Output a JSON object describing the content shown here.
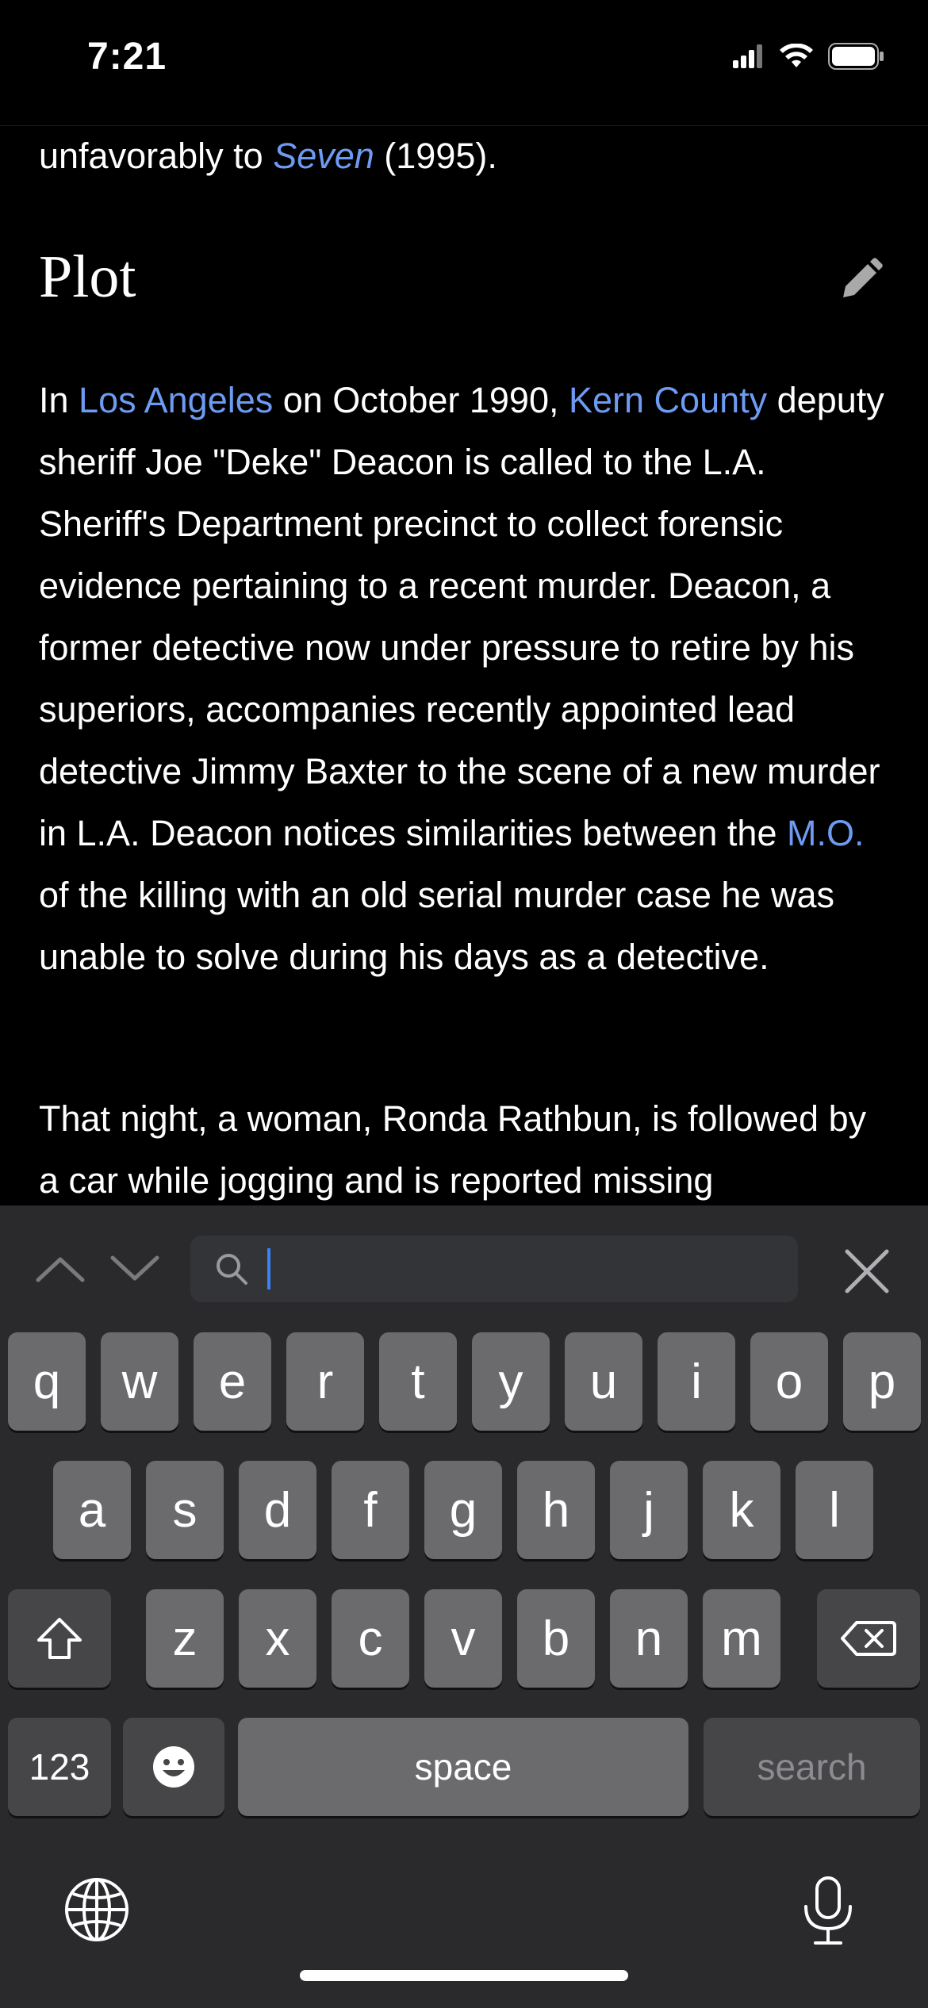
{
  "status": {
    "time": "7:21"
  },
  "article": {
    "intro_line": {
      "before": "unfavorably to ",
      "link": "Seven",
      "after": " (1995)."
    },
    "section_title": "Plot",
    "plot_paragraph": {
      "p1": "In ",
      "link1": "Los Angeles",
      "p2": " on October 1990, ",
      "link2": "Kern County",
      "p3": " deputy sheriff Joe \"Deke\" Deacon is called to the L.A. Sheriff's Department precinct to collect forensic evidence pertaining to a recent murder. Deacon, a former detective now under pressure to retire by his superiors, accompanies recently appointed lead detective Jimmy Baxter to the scene of a new murder in L.A. Deacon notices similarities between the ",
      "link3": "M.O.",
      "p4": " of the killing with an old serial murder case he was unable to solve during his days as a detective."
    },
    "next_paragraph": "That night, a woman, Ronda Rathbun, is followed by a car while jogging and is reported missing"
  },
  "find_bar": {
    "search_value": "",
    "search_placeholder": ""
  },
  "keyboard": {
    "row1": [
      "q",
      "w",
      "e",
      "r",
      "t",
      "y",
      "u",
      "i",
      "o",
      "p"
    ],
    "row2": [
      "a",
      "s",
      "d",
      "f",
      "g",
      "h",
      "j",
      "k",
      "l"
    ],
    "row3": [
      "z",
      "x",
      "c",
      "v",
      "b",
      "n",
      "m"
    ],
    "numbers_key": "123",
    "space_key": "space",
    "search_key": "search",
    "icons": {
      "shift": "shift-icon",
      "delete": "delete-icon",
      "emoji": "emoji-icon",
      "globe": "globe-icon",
      "mic": "microphone-icon"
    }
  },
  "colors": {
    "link": "#6e9bf2",
    "cursor": "#3b82f6"
  }
}
